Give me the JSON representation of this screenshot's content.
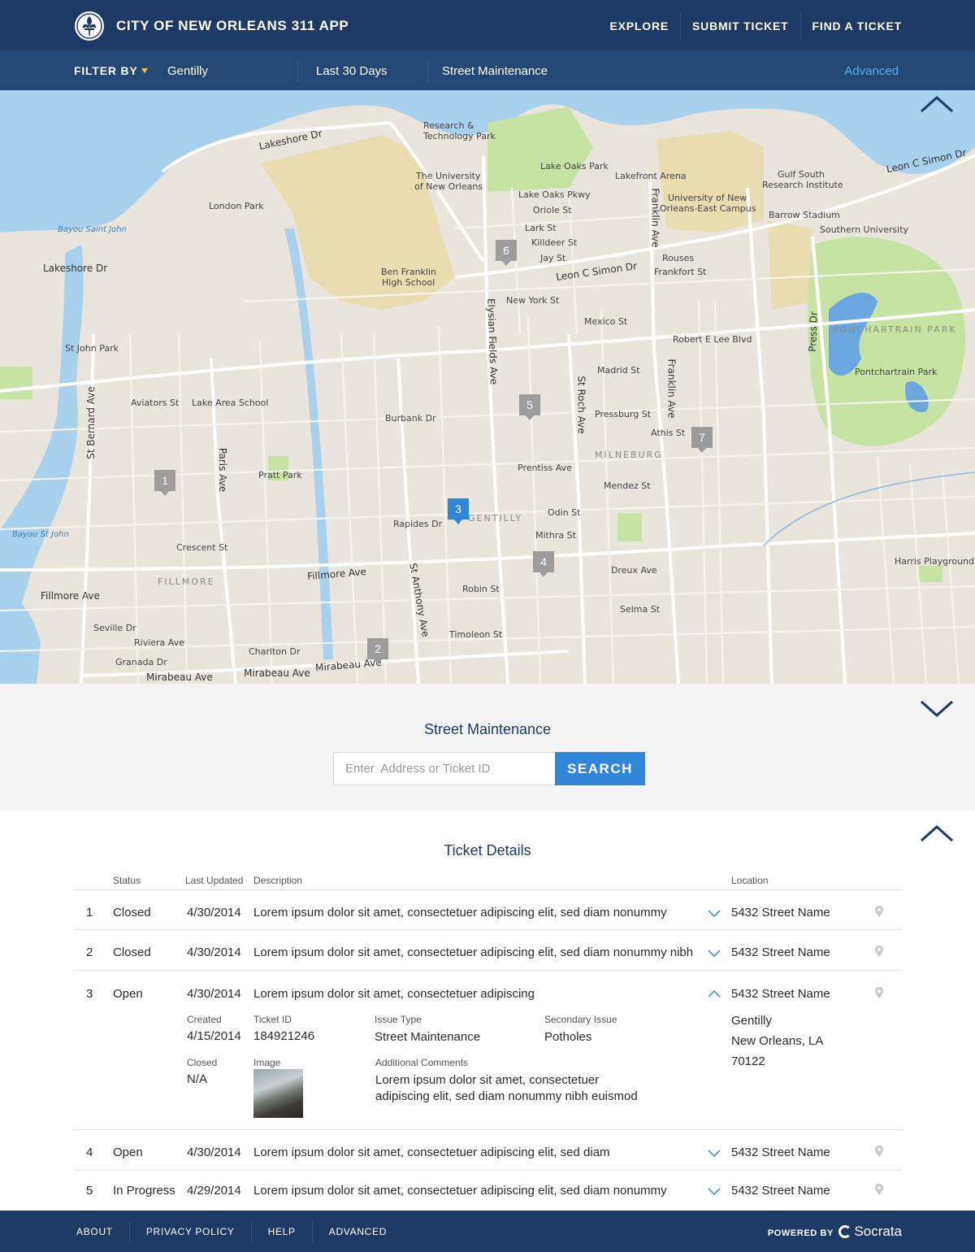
{
  "header": {
    "app_title": "CITY OF NEW ORLEANS 311 APP",
    "nav": [
      "EXPLORE",
      "SUBMIT TICKET",
      "FIND A TICKET"
    ]
  },
  "filter": {
    "label": "FILTER BY",
    "neighborhood": "Gentilly",
    "period": "Last 30 Days",
    "category": "Street Maintenance",
    "advanced": "Advanced"
  },
  "map": {
    "labels": {
      "research_park": "Research &",
      "research_park2": "Technology Park",
      "uno": "The University",
      "uno2": "of New Orleans",
      "lake_oaks_park": "Lake Oaks Park",
      "lakefront_arena": "Lakefront Arena",
      "gulf_south": "Gulf South",
      "gulf_south2": "Research Institute",
      "uno_east": "University of New",
      "uno_east2": "Orleans-East Campus",
      "barrow": "Barrow Stadium",
      "southern": "Southern University",
      "london_park": "London Park",
      "bayou_st_john": "Bayou Saint John",
      "lakeshore_dr": "Lakeshore Dr",
      "lakeshore_dr2": "Lakeshore Dr",
      "ben_franklin": "Ben Franklin",
      "ben_franklin2": "High School",
      "leon_c_simon": "Leon C Simon Dr",
      "leon_c_simon2": "Leon C Simon Dr",
      "rouses": "Rouses",
      "new_york_st": "New York St",
      "mexico_st": "Mexico St",
      "robert_e_lee": "Robert E Lee Blvd",
      "st_john_park": "St John Park",
      "pontchartrain_park": "PONCHARTRAIN PARK",
      "pontchartrain_park2": "Pontchartrain Park",
      "lake_area_school": "Lake Area School",
      "pratt_park": "Pratt Park",
      "milneburg": "MILNEBURG",
      "gentilly": "GENTILLY",
      "fillmore_hood": "FILLMORE",
      "fillmore_ave": "Fillmore Ave",
      "fillmore_ave2": "Fillmore Ave",
      "mirabeau_ave": "Mirabeau Ave",
      "mirabeau_ave2": "Mirabeau Ave",
      "mirabeau_ave3": "Mirabeau Ave",
      "elysian_fields": "Elysian Fields Ave",
      "st_bernard": "St Bernard Ave",
      "paris_ave": "Paris Ave",
      "franklin_ave": "Franklin Ave",
      "franklin_ave2": "Franklin Ave",
      "st_roch_ave": "St Roch Ave",
      "st_anthony": "St Anthony Ave",
      "harris_playground": "Harris Playground",
      "press_dr": "Press Dr",
      "bayou_st_john2": "Bayou St John",
      "odin_st": "Odin St",
      "mithra_st": "Mithra St",
      "crescent_st": "Crescent St",
      "rapides_dr": "Rapides Dr",
      "burbank_dr": "Burbank Dr",
      "madrid_st": "Madrid St",
      "aviators_st": "Aviators St",
      "prentiss_ave": "Prentiss Ave",
      "mendez_st": "Mendez St",
      "dreux_ave": "Dreux Ave",
      "selma_st": "Selma St",
      "robin_st": "Robin St",
      "timoleon_st": "Timoleon St",
      "charlton_dr": "Charlton Dr",
      "riviera_ave": "Riviera Ave",
      "granada_dr": "Granada Dr",
      "seville_dr": "Seville Dr",
      "lake_oaks_pkwy": "Lake Oaks Pkwy",
      "oriole_st": "Oriole St",
      "lark_st": "Lark St",
      "killdeer_st": "Killdeer St",
      "jay_st": "Jay St",
      "frankfort_st": "Frankfort St",
      "pressburg_st": "Pressburg St",
      "athis_st": "Athis St"
    },
    "markers": [
      "1",
      "2",
      "3",
      "4",
      "5",
      "6",
      "7"
    ]
  },
  "search": {
    "title": "Street Maintenance",
    "placeholder": "Enter  Address or Ticket ID",
    "button": "SEARCH"
  },
  "tickets": {
    "title": "Ticket Details",
    "columns": {
      "status": "Status",
      "last_updated": "Last Updated",
      "description": "Description",
      "location": "Location"
    },
    "rows": [
      {
        "num": "1",
        "status": "Closed",
        "updated": "4/30/2014",
        "desc": "Lorem ipsum dolor sit amet, consectetuer adipiscing elit, sed diam nonummy",
        "location": "5432 Street Name"
      },
      {
        "num": "2",
        "status": "Closed",
        "updated": "4/30/2014",
        "desc": "Lorem ipsum dolor sit amet, consectetuer adipiscing elit, sed diam nonummy nibh",
        "location": "5432 Street Name"
      },
      {
        "num": "3",
        "status": "Open",
        "updated": "4/30/2014",
        "desc": "Lorem ipsum dolor sit amet, consectetuer adipiscing",
        "location": "5432 Street Name"
      },
      {
        "num": "4",
        "status": "Open",
        "updated": "4/30/2014",
        "desc": "Lorem ipsum dolor sit amet, consectetuer adipiscing elit, sed diam",
        "location": "5432 Street Name"
      },
      {
        "num": "5",
        "status": "In Progress",
        "updated": "4/29/2014",
        "desc": "Lorem ipsum dolor sit amet, consectetuer adipiscing elit, sed diam nonummy",
        "location": "5432 Street Name"
      }
    ],
    "expanded": {
      "created_label": "Created",
      "created": "4/15/2014",
      "ticket_id_label": "Ticket ID",
      "ticket_id": "184921246",
      "issue_type_label": "Issue Type",
      "issue_type": "Street Maintenance",
      "secondary_label": "Secondary Issue",
      "secondary": "Potholes",
      "closed_label": "Closed",
      "closed": "N/A",
      "image_label": "Image",
      "comments_label": "Additional Comments",
      "comments_line1": "Lorem ipsum dolor sit amet, consectetuer",
      "comments_line2": "adipiscing elit, sed diam nonummy nibh euismod",
      "city": "Gentilly",
      "state": "New Orleans, LA",
      "zip": "70122"
    }
  },
  "footer": {
    "links": [
      "ABOUT",
      "PRIVACY POLICY",
      "HELP",
      "ADVANCED"
    ],
    "powered_by": "POWERED BY",
    "brand": "Socrata"
  },
  "colors": {
    "header": "#1c3a63",
    "filterbar": "#244773",
    "accent": "#2f86d9",
    "advanced_link": "#5bb0ef",
    "water": "#a8d1ee",
    "park": "#c6e3a4",
    "campus": "#e8dcb1"
  }
}
